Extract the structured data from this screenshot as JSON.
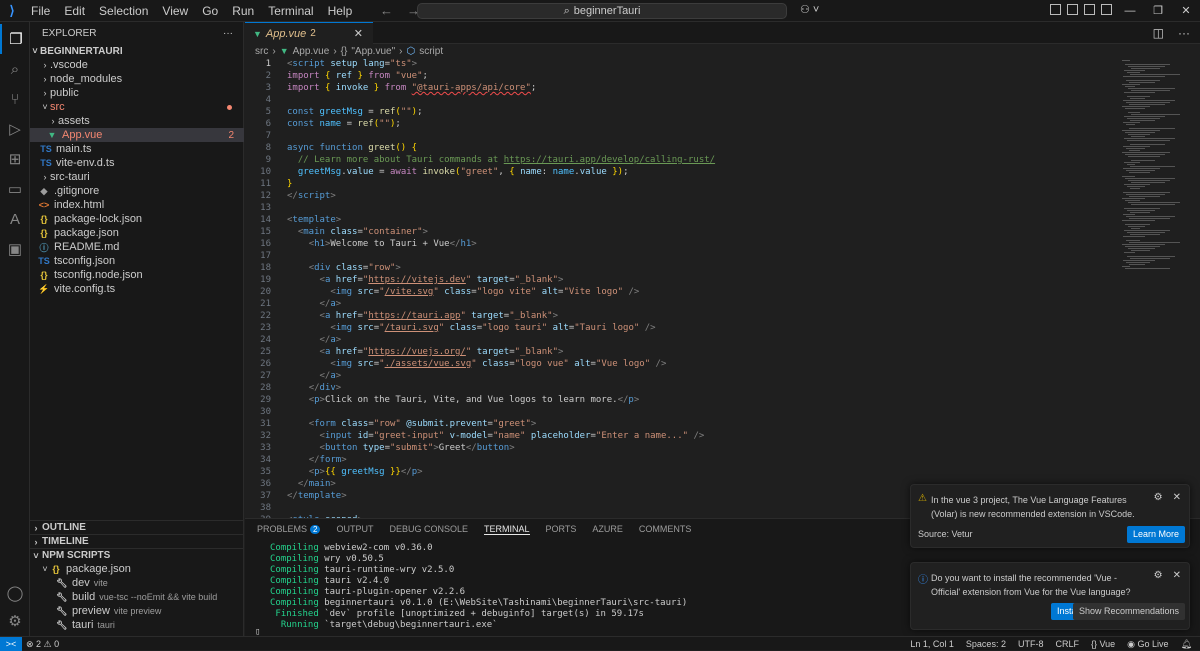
{
  "titlebar": {
    "menu": [
      "File",
      "Edit",
      "Selection",
      "View",
      "Go",
      "Run",
      "Terminal",
      "Help"
    ],
    "search_text": "beginnerTauri",
    "search_icon": "search-icon"
  },
  "explorer": {
    "header": "EXPLORER",
    "more": "···",
    "root": "BEGINNERTAURI",
    "items": [
      {
        "label": ".vscode"
      },
      {
        "label": "node_modules"
      },
      {
        "label": "public"
      },
      {
        "label": "src"
      },
      {
        "label": "assets"
      },
      {
        "label": "App.vue",
        "badge": "2"
      },
      {
        "label": "main.ts",
        "icon": "TS"
      },
      {
        "label": "vite-env.d.ts",
        "icon": "TS"
      },
      {
        "label": "src-tauri"
      },
      {
        "label": ".gitignore"
      },
      {
        "label": "index.html"
      },
      {
        "label": "package-lock.json",
        "icon": "{}"
      },
      {
        "label": "package.json",
        "icon": "{}"
      },
      {
        "label": "README.md"
      },
      {
        "label": "tsconfig.json",
        "icon": "TS"
      },
      {
        "label": "tsconfig.node.json",
        "icon": "{}"
      },
      {
        "label": "vite.config.ts"
      }
    ],
    "outline": "OUTLINE",
    "timeline": "TIMELINE",
    "npm": "NPM SCRIPTS",
    "npm_package": "package.json",
    "npm_scripts": [
      {
        "name": "dev",
        "cmd": "vite"
      },
      {
        "name": "build",
        "cmd": "vue-tsc --noEmit && vite build"
      },
      {
        "name": "preview",
        "cmd": "vite preview"
      },
      {
        "name": "tauri",
        "cmd": "tauri"
      }
    ]
  },
  "editor": {
    "tab_name": "App.vue",
    "tab_count": "2",
    "breadcrumb": [
      "src",
      "App.vue",
      "\"App.vue\"",
      "script"
    ],
    "current_line": "1"
  },
  "panel": {
    "tabs": [
      "PROBLEMS",
      "OUTPUT",
      "DEBUG CONSOLE",
      "TERMINAL",
      "PORTS",
      "AZURE",
      "COMMENTS"
    ],
    "problems_count": "2",
    "terminal": [
      {
        "kw": "Compiling",
        "rest": " webview2-com v0.36.0"
      },
      {
        "kw": "Compiling",
        "rest": " wry v0.50.5"
      },
      {
        "kw": "Compiling",
        "rest": " tauri-runtime-wry v2.5.0"
      },
      {
        "kw": "Compiling",
        "rest": " tauri v2.4.0"
      },
      {
        "kw": "Compiling",
        "rest": " tauri-plugin-opener v2.2.6"
      },
      {
        "kw": "Compiling",
        "rest": " beginnertauri v0.1.0 (E:\\WebSite\\Tashinami\\beginnerTauri\\src-tauri)"
      },
      {
        "kw": " Finished",
        "rest": " `dev` profile [unoptimized + debuginfo] target(s) in 59.17s"
      },
      {
        "kw": "  Running",
        "rest": " `target\\debug\\beginnertauri.exe`"
      }
    ]
  },
  "notifications": [
    {
      "message": "In the vue 3 project, The Vue Language Features (Volar) is new recommended extension in VSCode.",
      "source": "Source: Vetur",
      "primary": "Learn More"
    },
    {
      "message": "Do you want to install the recommended 'Vue - Official' extension from Vue for the Vue language?",
      "primary": "Install",
      "secondary": "Show Recommendations"
    }
  ],
  "status": {
    "remote": "><",
    "problems": "⊗ 2  ⚠ 0",
    "position": "Ln 1, Col 1",
    "spaces": "Spaces: 2",
    "encoding": "UTF-8",
    "eol": "CRLF",
    "language": "{} Vue",
    "golive": "Go Live"
  }
}
